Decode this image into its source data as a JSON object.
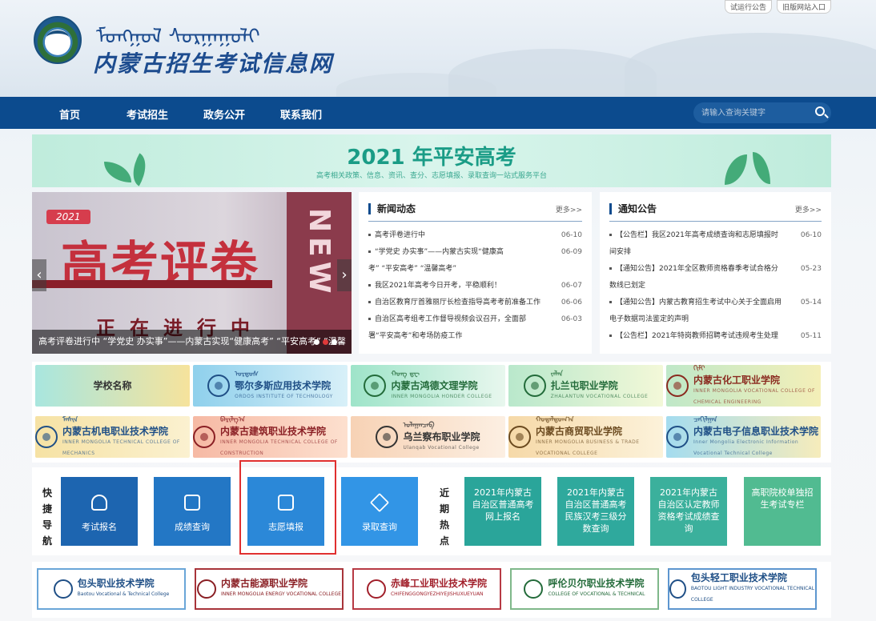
{
  "header": {
    "top_links": [
      "试运行公告",
      "旧版网站入口"
    ],
    "logo_mongolian": "ᠮᠣᠩᠭᠣᠯ ᠰᠤᠷᠭᠠᠭᠤᠯᠢ",
    "site_title": "内蒙古招生考试信息网"
  },
  "nav": {
    "items": [
      "首页",
      "考试招生",
      "政务公开",
      "联系我们"
    ],
    "search_placeholder": "请输入查询关键字"
  },
  "banner": {
    "title": "2021 年平安高考",
    "subtitle": "高考相关政策、信息、资讯、查分、志愿填报、录取查询一站式服务平台"
  },
  "slider": {
    "year": "2021",
    "headline": "高考评卷",
    "subline": "正在进行中",
    "side_text": "NEW",
    "caption": "高考评卷进行中 “学党史 办实事”——内蒙古实现“健康高考” “平安高考” “温馨",
    "prev": "‹",
    "next": "›"
  },
  "news": {
    "title": "新闻动态",
    "more": "更多>>",
    "rows": [
      {
        "text": "高考评卷进行中",
        "date": "06-10"
      },
      {
        "text": "“学党史 办实事”——内蒙古实现“健康高",
        "date": "06-09"
      },
      {
        "text": "考” “平安高考” “温馨高考”",
        "date": ""
      },
      {
        "text": "我区2021年高考今日开考，平稳顺利！",
        "date": "06-07"
      },
      {
        "text": "自治区教育厅首雅丽厅长检查指导高考考前准备工作",
        "date": "06-06"
      },
      {
        "text": "自治区高考组考工作督导视频会议召开，全面部",
        "date": "06-03"
      },
      {
        "text": "署“平安高考”和考场防疫工作",
        "date": ""
      }
    ]
  },
  "notices": {
    "title": "通知公告",
    "more": "更多>>",
    "rows": [
      {
        "text": "【公告栏】我区2021年高考成绩查询和志愿填报时",
        "date": "06-10"
      },
      {
        "text": "间安排",
        "date": ""
      },
      {
        "text": "【通知公告】2021年全区教师资格春季考试合格分",
        "date": "05-23"
      },
      {
        "text": "数线已划定",
        "date": ""
      },
      {
        "text": "【通知公告】内蒙古教育招生考试中心关于全面启用",
        "date": "05-14"
      },
      {
        "text": "电子数据司法鉴定的声明",
        "date": ""
      },
      {
        "text": "【公告栏】2021年特岗教师招聘考试违规考生处理",
        "date": "05-11"
      }
    ]
  },
  "schools": [
    {
      "name": "学校名称",
      "mg": "",
      "en": "",
      "bg": "linear-gradient(90deg,#a8e6df,#f6e39c)",
      "color": "#333333"
    },
    {
      "name": "鄂尔多斯应用技术学院",
      "mg": "ᠣᠷᠳᠣᠰ",
      "en": "ORDOS INSTITUTE OF TECHNOLOGY",
      "bg": "linear-gradient(90deg,#8fd0ec,#d8f0f8)",
      "color": "#1f4f86"
    },
    {
      "name": "内蒙古鸿德文理学院",
      "mg": "ᠬᠤᠩ ᠳᠧ",
      "en": "INNER MONGOLIA HONDER COLLEGE",
      "bg": "linear-gradient(90deg,#9ee4c9,#e8f7ee)",
      "color": "#236b3a"
    },
    {
      "name": "扎兰屯职业学院",
      "mg": "ᠵᠠᠯᠠᠨ",
      "en": "ZHALANTUN VOCATIONAL COLLEGE",
      "bg": "linear-gradient(90deg,#b9e8cc,#f3f8d8)",
      "color": "#236b3a"
    },
    {
      "name": "内蒙古化工职业学院",
      "mg": "ᠬᠢᠮᠢ",
      "en": "INNER MONGOLIA VOCATIONAL COLLEGE OF CHEMICAL ENGINEERING",
      "bg": "linear-gradient(90deg,#bfe8c8,#f4efb8)",
      "color": "#8a2a1f"
    },
    {
      "name": "内蒙古机电职业技术学院",
      "mg": "ᠮᠠᠰᠢᠨ",
      "en": "INNER MONGOLIA TECHNICAL COLLEGE OF MECHANICS",
      "bg": "linear-gradient(90deg,#f6e2a4,#fbf1d0)",
      "color": "#1f4f86"
    },
    {
      "name": "内蒙古建筑职业技术学院",
      "mg": "ᠪᠠᠷᠢᠯᠭ᠎ᠠ",
      "en": "INNER MONGOLIA TECHNICAL COLLEGE OF CONSTRUCTION",
      "bg": "linear-gradient(90deg,#f6b9a4,#fde0cf)",
      "color": "#8a1f24"
    },
    {
      "name": "乌兰察布职业学院",
      "mg": "ᠤᠯᠠᠭᠠᠨᠴᠠᠪ",
      "en": "Ulanqab Vocational College",
      "bg": "linear-gradient(90deg,#f7d2b5,#fcefe2)",
      "color": "#333333"
    },
    {
      "name": "内蒙古商贸职业学院",
      "mg": "ᠬᠤᠳᠠᠯᠳᠤᠭ᠎ᠠ",
      "en": "INNER MONGOLIA BUSINESS & TRADE VOCATIONAL COLLEGE",
      "bg": "linear-gradient(90deg,#f6d9a8,#fcf2da)",
      "color": "#6b4a1f"
    },
    {
      "name": "内蒙古电子信息职业技术学院",
      "mg": "ᠴᠠᠬᠢᠯᠭᠠᠨ",
      "en": "Inner Mongolia Electronic Information Vocational Technical College",
      "bg": "linear-gradient(90deg,#a4dcef,#f6ecbb)",
      "color": "#1f4f86"
    }
  ],
  "quick_nav": {
    "label": [
      "快",
      "捷",
      "导",
      "航"
    ],
    "buttons": [
      {
        "label": "考试报名",
        "icon": "person-edit-icon",
        "color": "#1d65b0"
      },
      {
        "label": "成绩查询",
        "icon": "chart-search-icon",
        "color": "#2377c5"
      },
      {
        "label": "志愿填报",
        "icon": "form-edit-icon",
        "color": "#2b88d8"
      },
      {
        "label": "录取查询",
        "icon": "graduation-cap-icon",
        "color": "#3295e6"
      }
    ]
  },
  "hot_topics": {
    "label": [
      "近",
      "期",
      "热",
      "点"
    ],
    "items": [
      {
        "label": "2021年内蒙古自治区普通高考网上报名",
        "color": "#2aa59a"
      },
      {
        "label": "2021年内蒙古自治区普通高考民族汉考三级分数查询",
        "color": "#2fa99d"
      },
      {
        "label": "2021年内蒙古自治区认定教师资格考试成绩查询",
        "color": "#3bb09c"
      },
      {
        "label": "高职院校单独招生考试专栏",
        "color": "#51bb91"
      }
    ]
  },
  "bottom_logos": [
    {
      "name": "包头职业技术学院",
      "en": "Baotou Vocational & Technical College",
      "color": "#1f4f86",
      "border": "#6aa6d8"
    },
    {
      "name": "内蒙古能源职业学院",
      "en": "INNER MONGOLIA ENERGY VOCATIONAL COLLEGE",
      "color": "#8a1f24",
      "border": "#a8343a"
    },
    {
      "name": "赤峰工业职业技术学院",
      "en": "CHIFENGGONGYEZHIYEJISHUXUEYUAN",
      "color": "#a11f2a",
      "border": "#b73a44"
    },
    {
      "name": "呼伦贝尔职业技术学院",
      "en": "COLLEGE OF VOCATIONAL & TECHNICAL",
      "color": "#236b3a",
      "border": "#7fb88a"
    },
    {
      "name": "包头轻工职业技术学院",
      "en": "BAOTOU LIGHT INDUSTRY VOCATIONAL TECHNICAL COLLEGE",
      "color": "#1f4f86",
      "border": "#5d96cf"
    }
  ]
}
